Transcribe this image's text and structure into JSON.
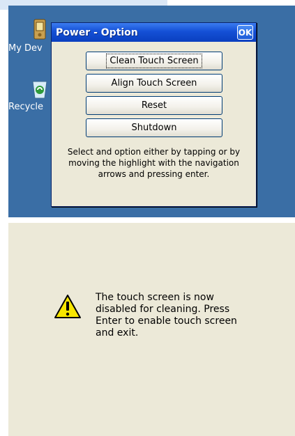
{
  "desktop": {
    "icons": [
      {
        "label": "My Dev",
        "icon": "my-device-icon"
      },
      {
        "label": "Recycle",
        "icon": "recycle-bin-icon"
      }
    ]
  },
  "dialog": {
    "title": "Power - Option",
    "ok_label": "OK",
    "buttons": [
      {
        "label": "Clean Touch Screen"
      },
      {
        "label": "Align Touch Screen"
      },
      {
        "label": "Reset"
      },
      {
        "label": "Shutdown"
      }
    ],
    "instructions": "Select and option either by tapping or by moving the highlight with the navigation arrows and pressing enter."
  },
  "panel": {
    "icon": "warning-icon",
    "message": "The touch screen is now disabled for cleaning.  Press Enter to enable touch screen and exit."
  },
  "colors": {
    "desktop": "#3a6ea5",
    "dialog_bg": "#ece9d8",
    "titlebar": "#1450d6"
  }
}
